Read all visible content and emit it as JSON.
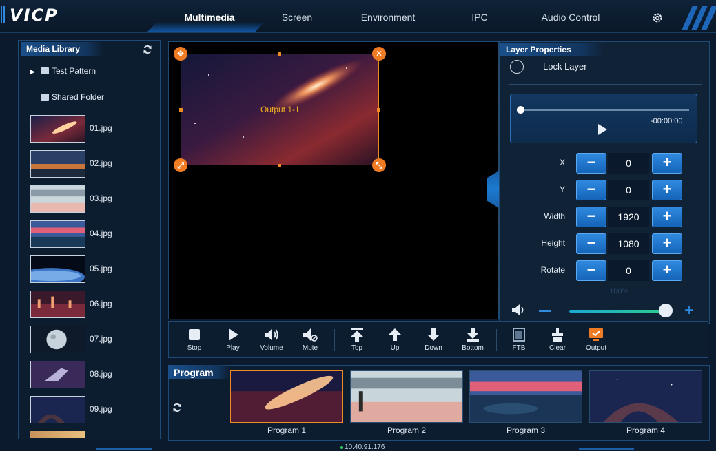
{
  "app": {
    "logo": "VICP"
  },
  "nav": {
    "tabs": [
      {
        "label": "Multimedia",
        "active": true
      },
      {
        "label": "Screen",
        "active": false
      },
      {
        "label": "Environment",
        "active": false
      },
      {
        "label": "IPC",
        "active": false
      },
      {
        "label": "Audio Control",
        "active": false
      }
    ],
    "settings_icon": "gear-icon"
  },
  "library": {
    "title": "Media Library",
    "refresh_icon": "refresh-icon",
    "folders": [
      {
        "label": "Test Pattern",
        "expandable": true
      },
      {
        "label": "Shared Folder",
        "expandable": false
      }
    ],
    "items": [
      {
        "label": "01.jpg"
      },
      {
        "label": "02.jpg"
      },
      {
        "label": "03.jpg"
      },
      {
        "label": "04.jpg"
      },
      {
        "label": "05.jpg"
      },
      {
        "label": "06.jpg"
      },
      {
        "label": "07.jpg"
      },
      {
        "label": "08.jpg"
      },
      {
        "label": "09.jpg"
      }
    ]
  },
  "canvas": {
    "layer_label": "Output 1-1"
  },
  "toolbar": {
    "stop": "Stop",
    "play": "Play",
    "volume": "Volume",
    "mute": "Mute",
    "top": "Top",
    "up": "Up",
    "down": "Down",
    "bottom": "Bottom",
    "ftb": "FTB",
    "clear": "Clear",
    "output": "Output"
  },
  "program": {
    "title": "Program",
    "items": [
      {
        "label": "Program 1",
        "selected": true
      },
      {
        "label": "Program 2",
        "selected": false
      },
      {
        "label": "Program 3",
        "selected": false
      },
      {
        "label": "Program 4",
        "selected": false
      }
    ]
  },
  "properties": {
    "title": "Layer Properties",
    "lock_label": "Lock Layer",
    "player_time": "-00:00:00",
    "fields": [
      {
        "label": "X",
        "value": "0"
      },
      {
        "label": "Y",
        "value": "0"
      },
      {
        "label": "Width",
        "value": "1920"
      },
      {
        "label": "Height",
        "value": "1080"
      },
      {
        "label": "Rotate",
        "value": "0"
      }
    ],
    "zoom_ghost": "100%",
    "volume_level": 0.92
  },
  "status": {
    "ip": "10.40.91.176"
  },
  "colors": {
    "accent": "#2f8ae0",
    "selection": "#f08a24",
    "background": "#0b1a2c"
  }
}
